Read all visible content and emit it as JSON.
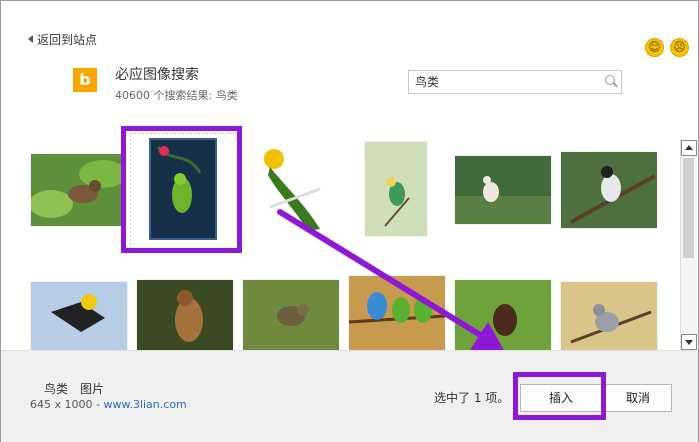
{
  "header": {
    "back_label": "返回到站点",
    "smiley_happy": "smiling-face-icon",
    "smiley_sad": "frowning-face-icon"
  },
  "search_provider": {
    "logo_letter": "b",
    "title": "必应图像搜索",
    "result_count": "40600 个搜索结果: 鸟类"
  },
  "search": {
    "value": "鸟类"
  },
  "thumbnails": [
    {
      "subject": "brown bird on green leaves",
      "bg": "#5e8f3a",
      "fg": "#7a5a3c"
    },
    {
      "subject": "green parrot on flowering branch",
      "bg": "#17304a",
      "fg": "#6bb52c",
      "selected": true
    },
    {
      "subject": "yellow-headed parrot on perch",
      "bg": "#ffffff",
      "fg": "#3a7a1e"
    },
    {
      "subject": "bee-eater on twig",
      "bg": "#cfe0b8",
      "fg": "#3c9a5a"
    },
    {
      "subject": "egret in grass",
      "bg": "#3f6b3a",
      "fg": "#f0e8dc"
    },
    {
      "subject": "black-capped bird on branch",
      "bg": "#4e6f3e",
      "fg": "#e8e8e8"
    },
    {
      "subject": "yellow and black bird calling",
      "bg": "#b7cde6",
      "fg": "#222222"
    },
    {
      "subject": "falcon perched",
      "bg": "#3a4a22",
      "fg": "#a6723c"
    },
    {
      "subject": "speckled bird on twig",
      "bg": "#6f8a3e",
      "fg": "#6a5e3c"
    },
    {
      "subject": "lovebirds on branch",
      "bg": "#c79a4e",
      "fg": "#3a8ad6"
    },
    {
      "subject": "dark bird on leaves",
      "bg": "#6ea33c",
      "fg": "#4a2a1a"
    },
    {
      "subject": "tufted titmouse on branch",
      "bg": "#d9c58a",
      "fg": "#9a9fa8"
    }
  ],
  "footer": {
    "image_name": "鸟类",
    "image_type": "图片",
    "dimensions": "645 x 1000 - ",
    "source": "www.3lian.com",
    "status": "选中了 1 项。",
    "insert_label": "插入",
    "cancel_label": "取消"
  },
  "colors": {
    "highlight": "#8e18d6",
    "bing_logo": "#f7a600",
    "link": "#2a6ebb"
  }
}
